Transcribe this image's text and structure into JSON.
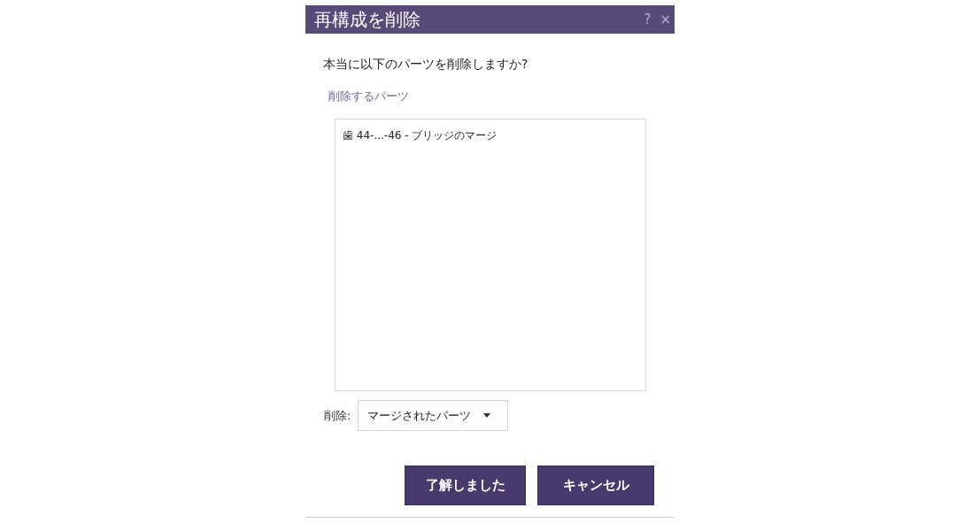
{
  "window": {
    "title": "再構成を削除",
    "help": "?",
    "close": "×"
  },
  "question": "本当に以下のパーツを削除しますか?",
  "list_label": "削除するパーツ",
  "parts": [
    "歯 44-...-46 - ブリッジのマージ"
  ],
  "delete": {
    "label": "削除:",
    "value": "マージされたパーツ"
  },
  "buttons": [
    "了解しました",
    "キャンセル"
  ]
}
